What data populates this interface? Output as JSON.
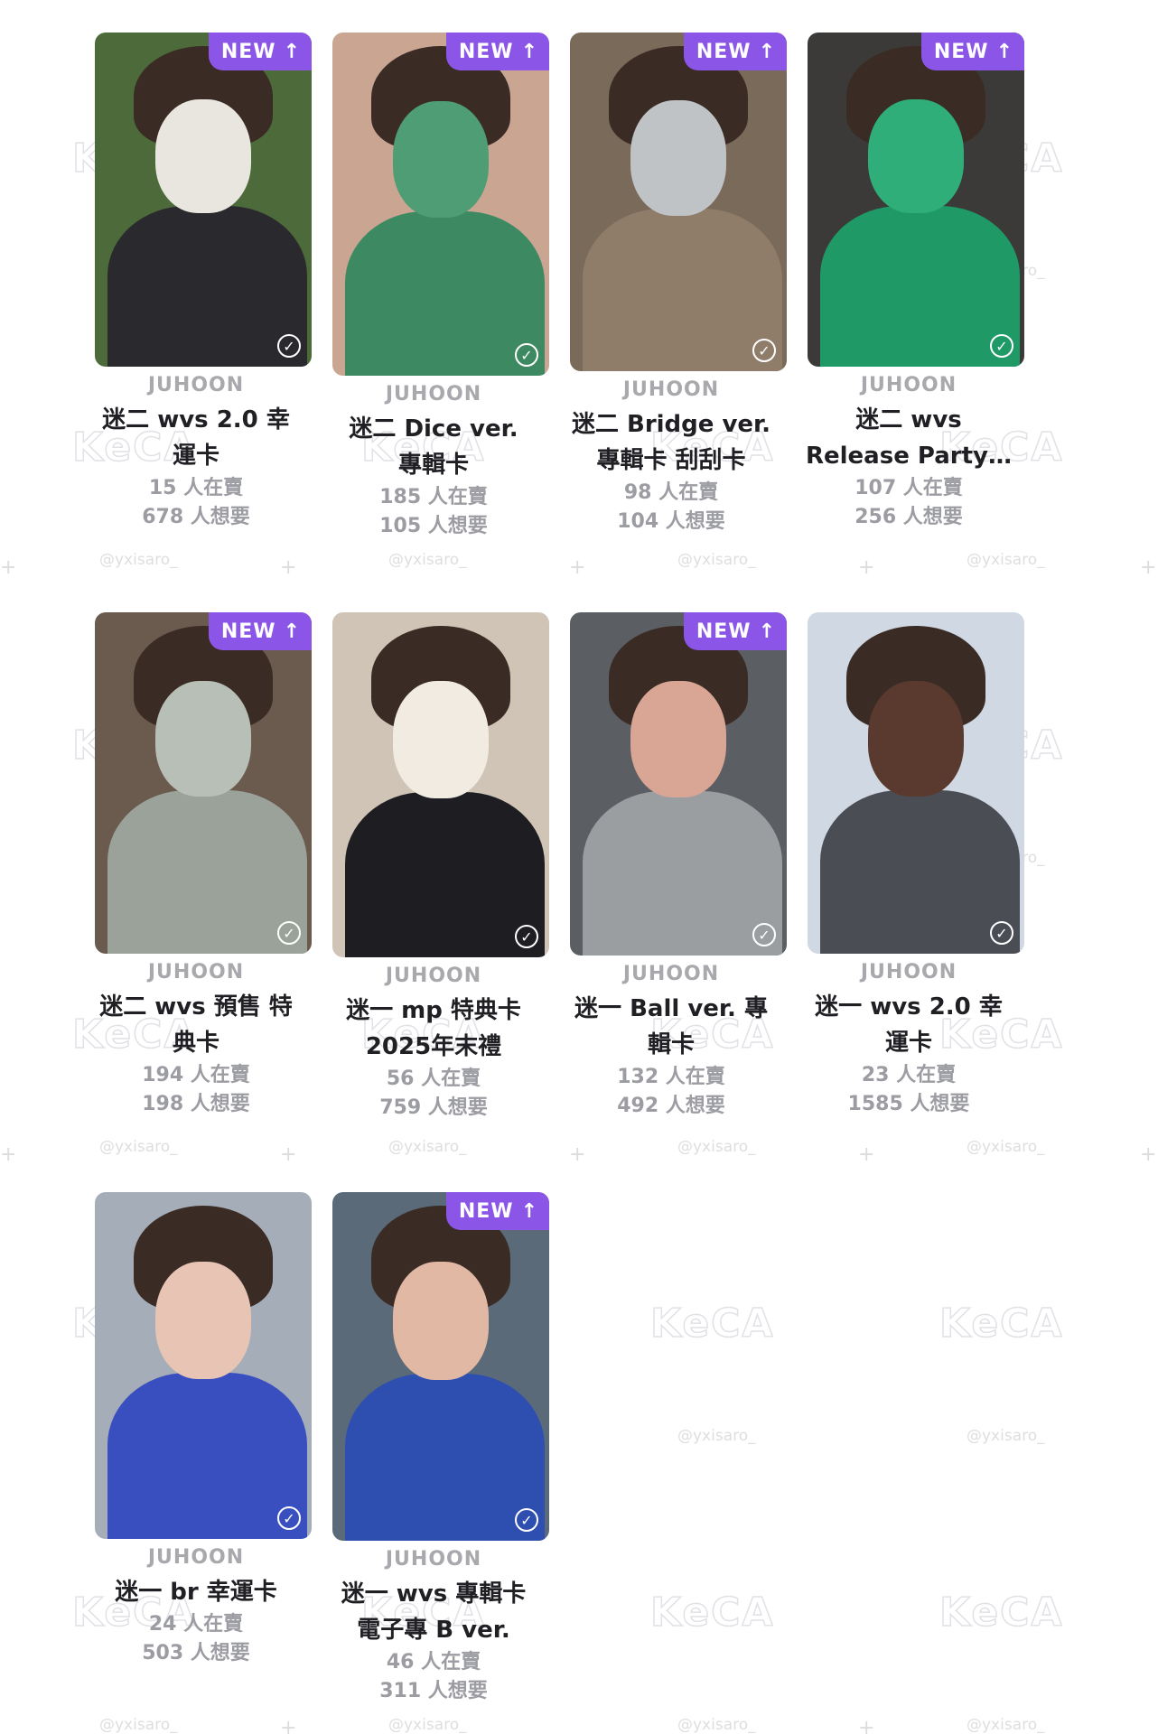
{
  "watermark": {
    "logo": "KeCA",
    "handle": "@yxisaro_",
    "plus": "+"
  },
  "new_badge": {
    "label": "NEW",
    "arrow": "↑"
  },
  "check_glyph": "✓",
  "cards": [
    {
      "artist": "JUHOON",
      "title_line1": "迷二 wvs 2.0 幸",
      "title_line2": "運卡",
      "selling": "15 人在賣",
      "wanting": "678 人想要",
      "is_new": true,
      "colors": [
        "#4d6b3a",
        "#e8e6df",
        "#2a2a2e"
      ]
    },
    {
      "artist": "JUHOON",
      "title_line1": "迷二 Dice ver.",
      "title_line2": "專輯卡",
      "selling": "185 人在賣",
      "wanting": "105 人想要",
      "is_new": true,
      "colors": [
        "#c9a592",
        "#4f9d74",
        "#3d8a62"
      ]
    },
    {
      "artist": "JUHOON",
      "title_line1": "迷二 Bridge ver.",
      "title_line2": "專輯卡 刮刮卡",
      "selling": "98 人在賣",
      "wanting": "104 人想要",
      "is_new": true,
      "colors": [
        "#7a6a5a",
        "#bfc3c6",
        "#8f7d6a"
      ]
    },
    {
      "artist": "JUHOON",
      "title_line1": "迷二 wvs",
      "title_line2": "Release Party…",
      "selling": "107 人在賣",
      "wanting": "256 人想要",
      "is_new": true,
      "colors": [
        "#3b3a38",
        "#2fae7a",
        "#1f9a66"
      ]
    },
    {
      "artist": "JUHOON",
      "title_line1": "迷二 wvs 預售 特",
      "title_line2": "典卡",
      "selling": "194 人在賣",
      "wanting": "198 人想要",
      "is_new": true,
      "colors": [
        "#6b5a4e",
        "#b8bfb6",
        "#9aa29a"
      ]
    },
    {
      "artist": "JUHOON",
      "title_line1": "迷一 mp 特典卡",
      "title_line2": "2025年末禮",
      "selling": "56 人在賣",
      "wanting": "759 人想要",
      "is_new": false,
      "colors": [
        "#cfc4b6",
        "#f1ebe2",
        "#1d1d22"
      ]
    },
    {
      "artist": "JUHOON",
      "title_line1": "迷一 Ball ver. 專",
      "title_line2": "輯卡",
      "selling": "132 人在賣",
      "wanting": "492 人想要",
      "is_new": true,
      "colors": [
        "#5b5f63",
        "#d9a595",
        "#9b9ea1"
      ]
    },
    {
      "artist": "JUHOON",
      "title_line1": "迷一 wvs 2.0 幸",
      "title_line2": "運卡",
      "selling": "23 人在賣",
      "wanting": "1585 人想要",
      "is_new": false,
      "colors": [
        "#cfd8e3",
        "#5a3a2e",
        "#4b4d55"
      ]
    },
    {
      "artist": "JUHOON",
      "title_line1": "迷一 br 幸運卡",
      "title_line2": "",
      "selling": "24 人在賣",
      "wanting": "503 人想要",
      "is_new": false,
      "colors": [
        "#a5aeb8",
        "#e8c4b4",
        "#3a4fbf"
      ]
    },
    {
      "artist": "JUHOON",
      "title_line1": "迷一 wvs 專輯卡",
      "title_line2": "電子專 B ver.",
      "selling": "46 人在賣",
      "wanting": "311 人想要",
      "is_new": true,
      "colors": [
        "#5b6a78",
        "#e0b8a4",
        "#2f4fb0"
      ]
    }
  ]
}
